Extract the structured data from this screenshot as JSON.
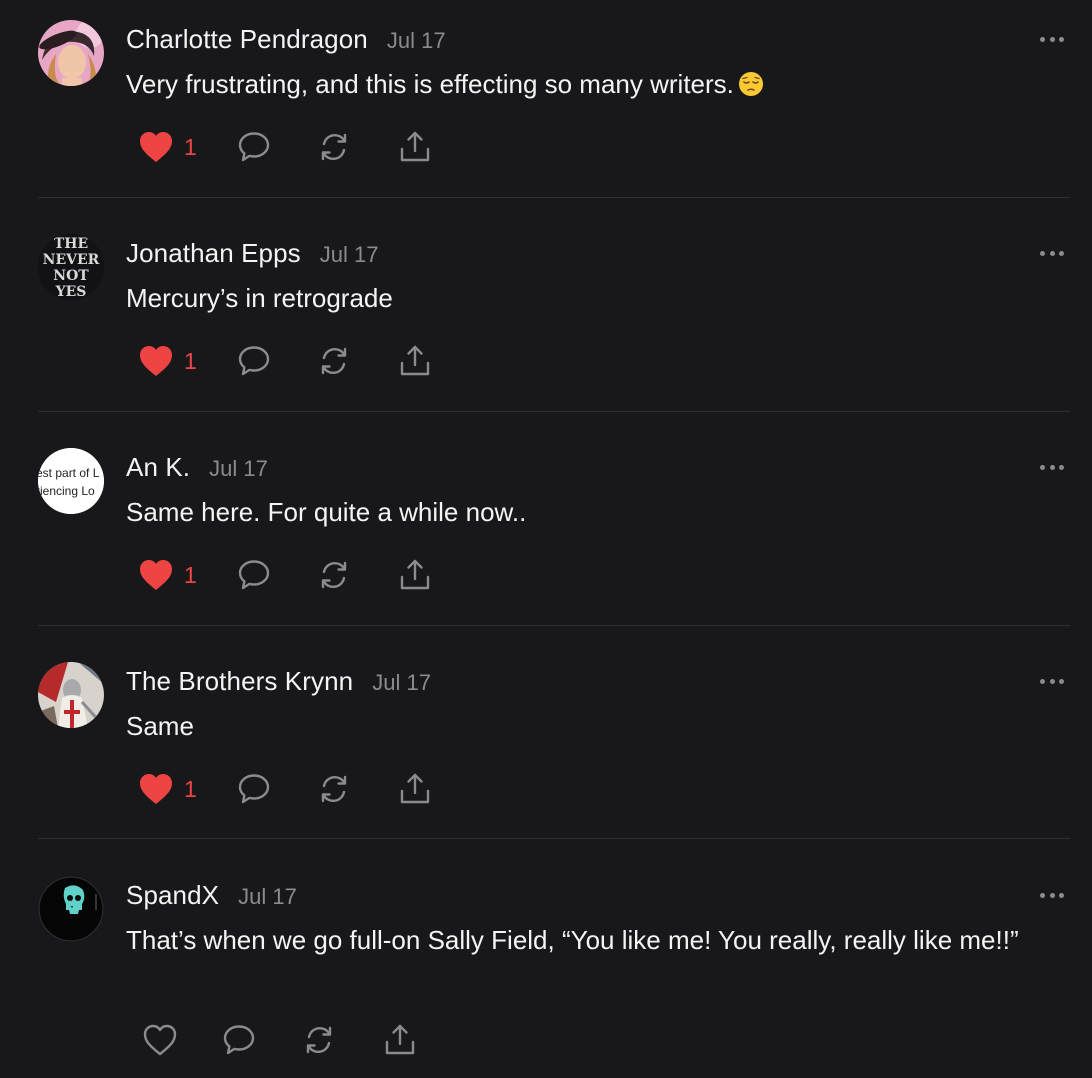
{
  "comments": [
    {
      "author": "Charlotte Pendragon",
      "date": "Jul 17",
      "text": "Very frustrating, and this is effecting so many writers.",
      "emoji": "pensive-face-emoji",
      "likes": "1",
      "liked": true,
      "avatar": "portrait-woman-with-hat"
    },
    {
      "author": "Jonathan Epps",
      "date": "Jul 17",
      "text": "Mercury’s in retrograde",
      "likes": "1",
      "liked": true,
      "avatar": "book-title-logo",
      "avatar_text": [
        "THE",
        "NEVER",
        "NOT",
        "YES"
      ]
    },
    {
      "author": "An K.",
      "date": "Jul 17",
      "text": "Same here. For quite a while now..",
      "likes": "1",
      "liked": true,
      "avatar": "text-snippet",
      "avatar_text": [
        "est part of L",
        "riencing Lo"
      ]
    },
    {
      "author": "The Brothers Krynn",
      "date": "Jul 17",
      "text": "Same",
      "likes": "1",
      "liked": true,
      "avatar": "knight-illustration"
    },
    {
      "author": "SpandX",
      "date": "Jul 17",
      "text": "That’s when we go full-on Sally Field, “You like me! You really, really like me!!”",
      "likes": "",
      "liked": false,
      "avatar": "skull-icon-dark"
    }
  ],
  "icons": {
    "like": "heart-icon",
    "reply": "speech-bubble-icon",
    "restack": "refresh-arrows-icon",
    "share": "share-upload-icon",
    "more": "ellipsis-icon"
  },
  "colors": {
    "background": "#18181b",
    "like_active": "#ef4444",
    "muted": "#8b8b8f",
    "divider": "#2e2e33"
  }
}
